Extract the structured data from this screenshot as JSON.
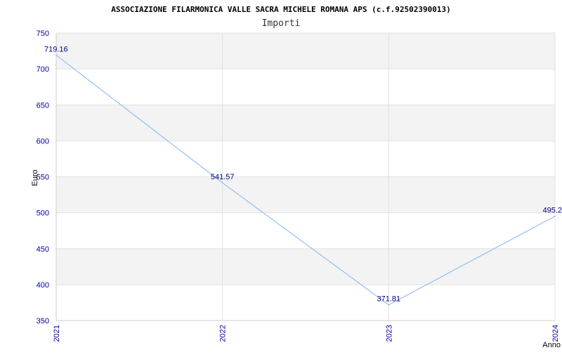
{
  "chart_data": {
    "type": "line",
    "title": "ASSOCIAZIONE FILARMONICA VALLE SACRA MICHELE ROMANA APS (c.f.92502390013)",
    "subtitle": "Importi",
    "xlabel": "Anno",
    "ylabel": "Euro",
    "categories": [
      "2021",
      "2022",
      "2023",
      "2024"
    ],
    "series": [
      {
        "values": [
          719.16,
          541.57,
          371.81,
          495.2
        ],
        "labels": [
          "719.16",
          "541.57",
          "371.81",
          "495.2"
        ],
        "color": "#7fb5f0"
      }
    ],
    "ylim": [
      350,
      750
    ],
    "yticks": [
      350,
      400,
      450,
      500,
      550,
      600,
      650,
      700,
      750
    ],
    "grid": true,
    "band_colors": [
      "#f3f3f3",
      "#ffffff"
    ]
  }
}
